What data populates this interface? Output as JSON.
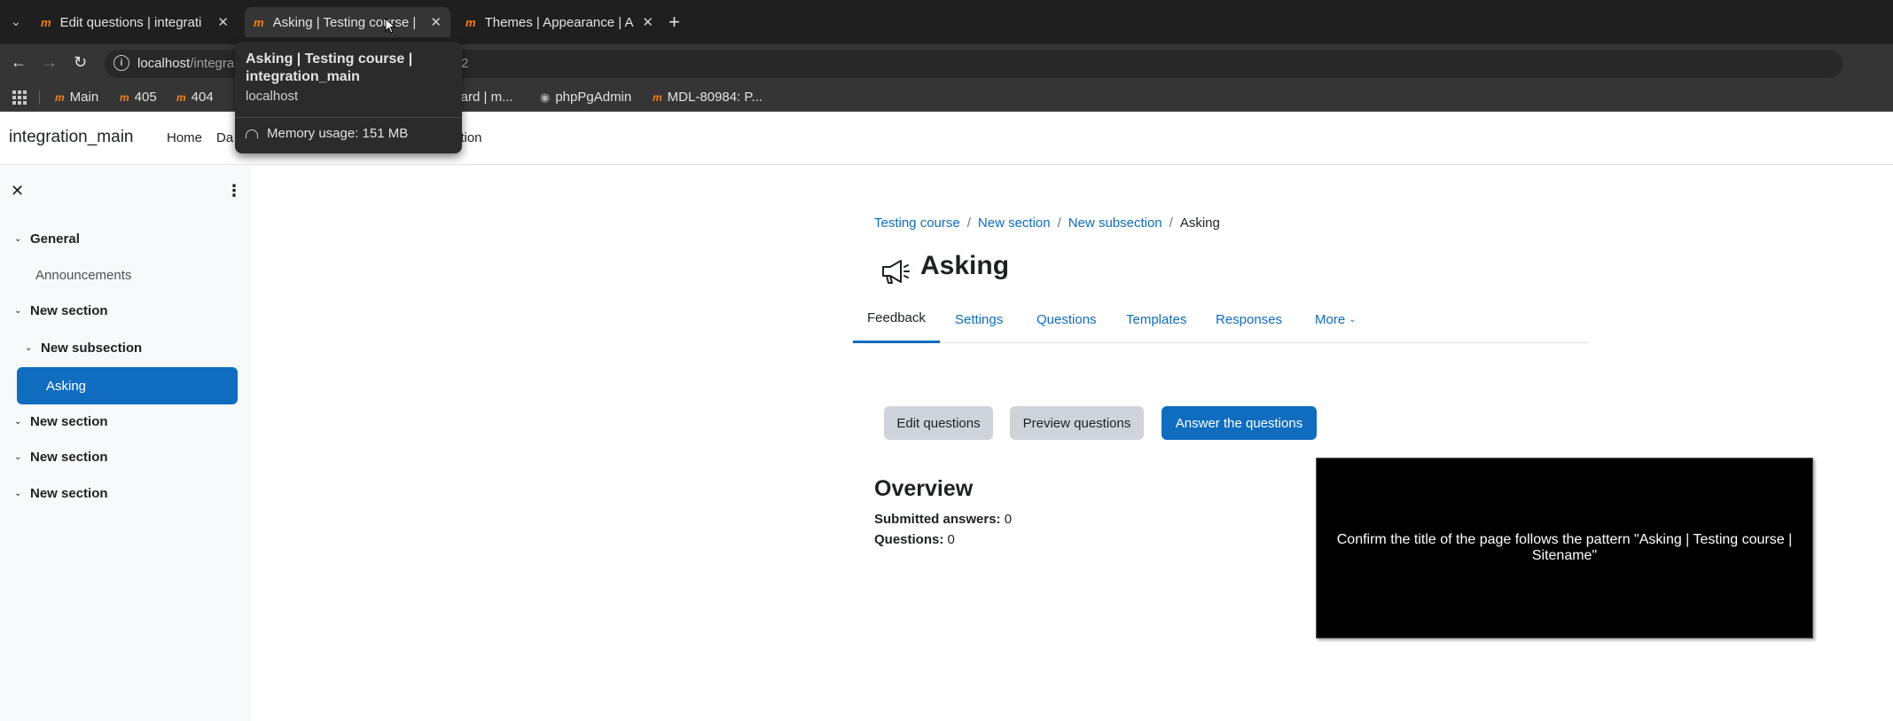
{
  "browser": {
    "tabs": [
      {
        "title": "Edit questions | integrati",
        "active": false
      },
      {
        "title": "Asking | Testing course |",
        "active": true
      },
      {
        "title": "Themes | Appearance | A",
        "active": false
      }
    ],
    "url_host": "localhost",
    "url_rest": "/integra",
    "url_tail": "2",
    "bookmarks": [
      {
        "label": "Main",
        "icon": "moodle-favicon"
      },
      {
        "label": "405",
        "icon": "moodle-favicon"
      },
      {
        "label": "404",
        "icon": "moodle-favicon"
      },
      {
        "label": "board | m...",
        "icon": "none"
      },
      {
        "label": "phpPgAdmin",
        "icon": "elephant-favicon"
      },
      {
        "label": "MDL-80984: P...",
        "icon": "moodle-favicon"
      }
    ],
    "hovercard": {
      "title": "Asking | Testing course | integration_main",
      "host": "localhost",
      "memory": "Memory usage: 151 MB"
    }
  },
  "navbar": {
    "site_name": "integration_main",
    "links": [
      "Home",
      "Da",
      "ation"
    ]
  },
  "course_index": {
    "sections": [
      {
        "label": "General"
      },
      {
        "label": "Announcements"
      },
      {
        "label": "New section"
      },
      {
        "label": "New subsection"
      },
      {
        "label": "Asking"
      },
      {
        "label": "New section"
      },
      {
        "label": "New section"
      },
      {
        "label": "New section"
      }
    ]
  },
  "main": {
    "breadcrumb": [
      "Testing course",
      "New section",
      "New subsection",
      "Asking"
    ],
    "title": "Asking",
    "tabs": [
      "Feedback",
      "Settings",
      "Questions",
      "Templates",
      "Responses",
      "More"
    ],
    "buttons": {
      "edit": "Edit questions",
      "preview": "Preview questions",
      "answer": "Answer the questions"
    },
    "overview": {
      "heading": "Overview",
      "submitted_label": "Submitted answers:",
      "submitted_value": "0",
      "questions_label": "Questions:",
      "questions_value": "0"
    },
    "note": "Confirm the title of the page follows the pattern \"Asking | Testing course | Sitename\""
  },
  "colors": {
    "primary": "#0f6cbf",
    "moodle_orange": "#f98012",
    "chrome_dark": "#1f1f1f",
    "drawer_bg": "#f8f9fa"
  }
}
